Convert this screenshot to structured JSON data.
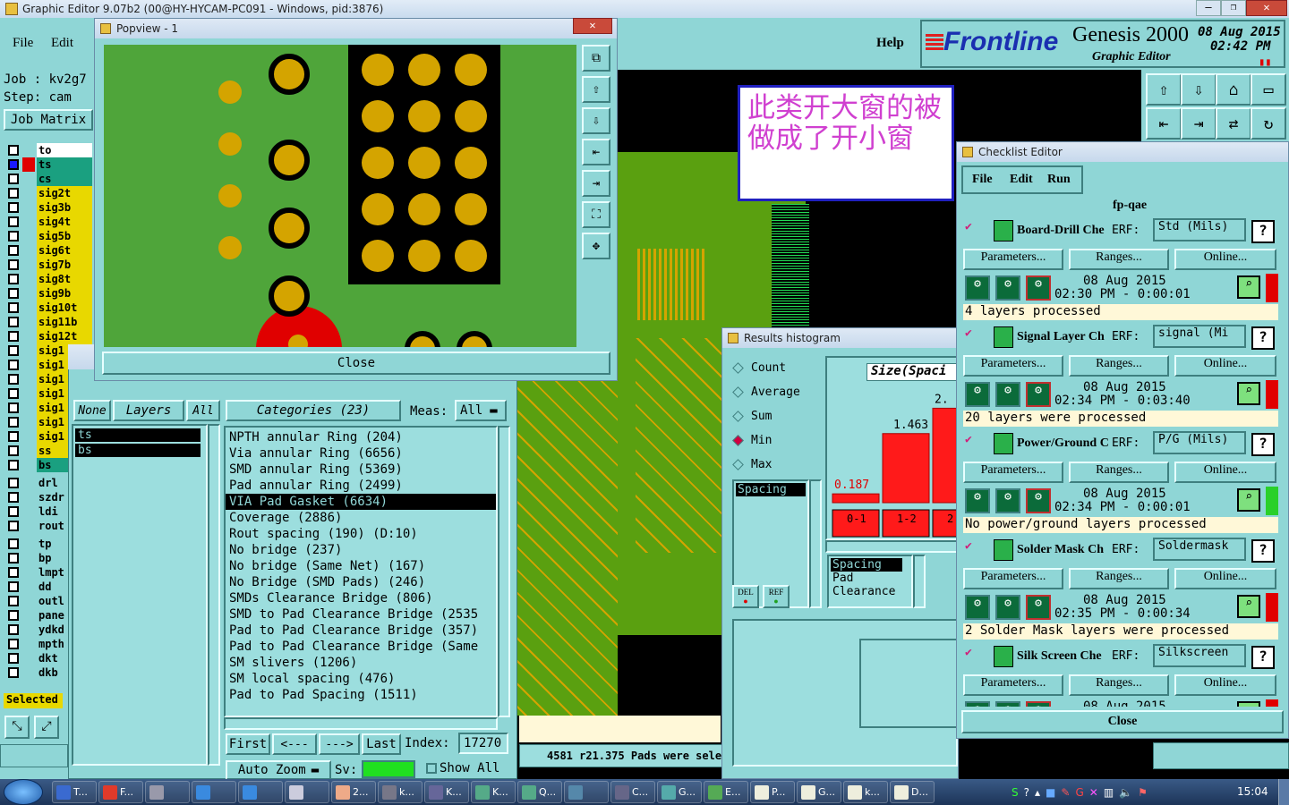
{
  "titlebar": {
    "text": "Graphic Editor 9.07b2 (00@HY-HYCAM-PC091 - Windows, pid:3876)"
  },
  "menu": {
    "file": "File",
    "edit": "Edit",
    "help": "Help"
  },
  "brand": {
    "name": "Frontline",
    "product": "Genesis 2000",
    "subtitle": "Graphic Editor",
    "date": "08 Aug 2015",
    "time": "02:42 PM"
  },
  "job": {
    "label": "Job : kv2g7",
    "step": "Step: cam",
    "matrix": "Job Matrix"
  },
  "layers": [
    {
      "name": "to",
      "color": "#ffffff"
    },
    {
      "name": "ts",
      "color": "#1aa080"
    },
    {
      "name": "cs",
      "color": "#1aa080"
    },
    {
      "name": "sig2t",
      "color": "#e8d800"
    },
    {
      "name": "sig3b",
      "color": "#e8d800"
    },
    {
      "name": "sig4t",
      "color": "#e8d800"
    },
    {
      "name": "sig5b",
      "color": "#e8d800"
    },
    {
      "name": "sig6t",
      "color": "#e8d800"
    },
    {
      "name": "sig7b",
      "color": "#e8d800"
    },
    {
      "name": "sig8t",
      "color": "#e8d800"
    },
    {
      "name": "sig9b",
      "color": "#e8d800"
    },
    {
      "name": "sig10t",
      "color": "#e8d800"
    },
    {
      "name": "sig11b",
      "color": "#e8d800"
    },
    {
      "name": "sig12t",
      "color": "#e8d800"
    },
    {
      "name": "sig1",
      "color": "#e8d800"
    },
    {
      "name": "sig1",
      "color": "#e8d800"
    },
    {
      "name": "sig1",
      "color": "#e8d800"
    },
    {
      "name": "sig1",
      "color": "#e8d800"
    },
    {
      "name": "sig1",
      "color": "#e8d800"
    },
    {
      "name": "sig1",
      "color": "#e8d800"
    },
    {
      "name": "sig1",
      "color": "#e8d800"
    },
    {
      "name": "ss",
      "color": "#e8d800"
    },
    {
      "name": "bs",
      "color": "#1aa080"
    }
  ],
  "layers2": [
    {
      "name": "drl",
      "color": "#8fd6d6"
    },
    {
      "name": "szdr",
      "color": "#8fd6d6"
    },
    {
      "name": "ldi",
      "color": "#8fd6d6"
    },
    {
      "name": "rout",
      "color": "#8fd6d6"
    }
  ],
  "layers3": [
    {
      "name": "tp"
    },
    {
      "name": "bp"
    },
    {
      "name": "lmpt"
    },
    {
      "name": "dd"
    },
    {
      "name": "outl"
    },
    {
      "name": "pane"
    },
    {
      "name": "ydkd"
    },
    {
      "name": "mpth"
    },
    {
      "name": "dkt"
    },
    {
      "name": "dkb"
    }
  ],
  "selected_label": "Selected",
  "popview": {
    "title": "Popview - 1",
    "close": "Close"
  },
  "annotation": {
    "text": "此类开大窗的被做成了开小窗"
  },
  "solder": {
    "none": "None",
    "layers": "Layers",
    "all": "All",
    "categories": "Categories (23)",
    "meas": "Meas:",
    "meas_val": "All",
    "layer_items": [
      "ts",
      "bs"
    ],
    "items": [
      "NPTH annular Ring (204)",
      "Via annular Ring (6656)",
      "SMD annular Ring (5369)",
      "Pad annular Ring (2499)",
      "VIA Pad Gasket (6634)",
      "Coverage (2886)",
      "Rout spacing (190)        (D:10)",
      "No bridge (237)",
      "No bridge (Same Net) (167)",
      "No Bridge (SMD Pads) (246)",
      "SMDs Clearance Bridge (806)",
      "SMD to Pad Clearance Bridge (2535",
      "Pad to Pad Clearance Bridge (357)",
      "Pad to Pad Clearance Bridge (Same",
      "SM slivers (1206)",
      "SM local spacing (476)",
      "Pad to Pad Spacing (1511)"
    ],
    "first": "First",
    "prev": "<---",
    "next": "--->",
    "last": "Last",
    "index_label": "Index:",
    "index_val": "17270",
    "autozoom": "Auto Zoom",
    "sv": "Sv:",
    "showall": "Show All"
  },
  "status": {
    "text": "4581 r21.375 Pads were selec"
  },
  "histogram": {
    "title": "Results histogram",
    "modes": [
      "Count",
      "Average",
      "Sum",
      "Min",
      "Max"
    ],
    "selected_mode": "Min",
    "size_label": "Size(Spaci",
    "list_sel": "Spacing",
    "labels": [
      "Spacing",
      "Pad",
      "Clearance"
    ],
    "del": "DEL",
    "ref": "REF",
    "v1": "0.187",
    "v2": "1.463",
    "v3": "2.",
    "bins": [
      "0-\n1",
      "1-\n2",
      "2"
    ]
  },
  "chart_data": {
    "type": "bar",
    "categories": [
      "0-1",
      "1-2",
      "2"
    ],
    "values": [
      0.187,
      1.463,
      2.0
    ],
    "title": "",
    "xlabel": "",
    "ylabel": "Size(Spaci"
  },
  "checklist": {
    "title": "Checklist Editor",
    "file": "File",
    "edit": "Edit",
    "run": "Run",
    "name": "fp-qae",
    "close": "Close",
    "params": "Parameters...",
    "ranges": "Ranges...",
    "online": "Online...",
    "erf": "ERF:",
    "checks": [
      {
        "name": "Board-Drill Che",
        "erf": "Std (Mils)",
        "date": "08 Aug 2015",
        "time": "02:30 PM - 0:00:01",
        "msg": "4 layers processed",
        "status": "#e00000"
      },
      {
        "name": "Signal Layer Ch",
        "erf": "signal (Mi",
        "date": "08 Aug 2015",
        "time": "02:34 PM - 0:03:40",
        "msg": "20 layers were processed",
        "status": "#e00000"
      },
      {
        "name": "Power/Ground C",
        "erf": "P/G (Mils)",
        "date": "08 Aug 2015",
        "time": "02:34 PM - 0:00:01",
        "msg": "No power/ground layers processed",
        "status": "#2ad02a"
      },
      {
        "name": "Solder Mask Ch",
        "erf": "Soldermask",
        "date": "08 Aug 2015",
        "time": "02:35 PM - 0:00:34",
        "msg": "2 Solder Mask layers were processed",
        "status": "#e00000"
      },
      {
        "name": "Silk Screen Che",
        "erf": "Silkscreen",
        "date": "08 Aug 2015",
        "time": "",
        "msg": "",
        "status": "#e00000"
      }
    ]
  },
  "taskbar": {
    "clock": "15:04",
    "items": [
      "T...",
      "F...",
      "",
      "",
      "",
      "",
      "2...",
      "k...",
      "K...",
      "K...",
      "Q...",
      "",
      "C...",
      "G...",
      "E...",
      "P...",
      "G...",
      "k...",
      "D..."
    ]
  }
}
